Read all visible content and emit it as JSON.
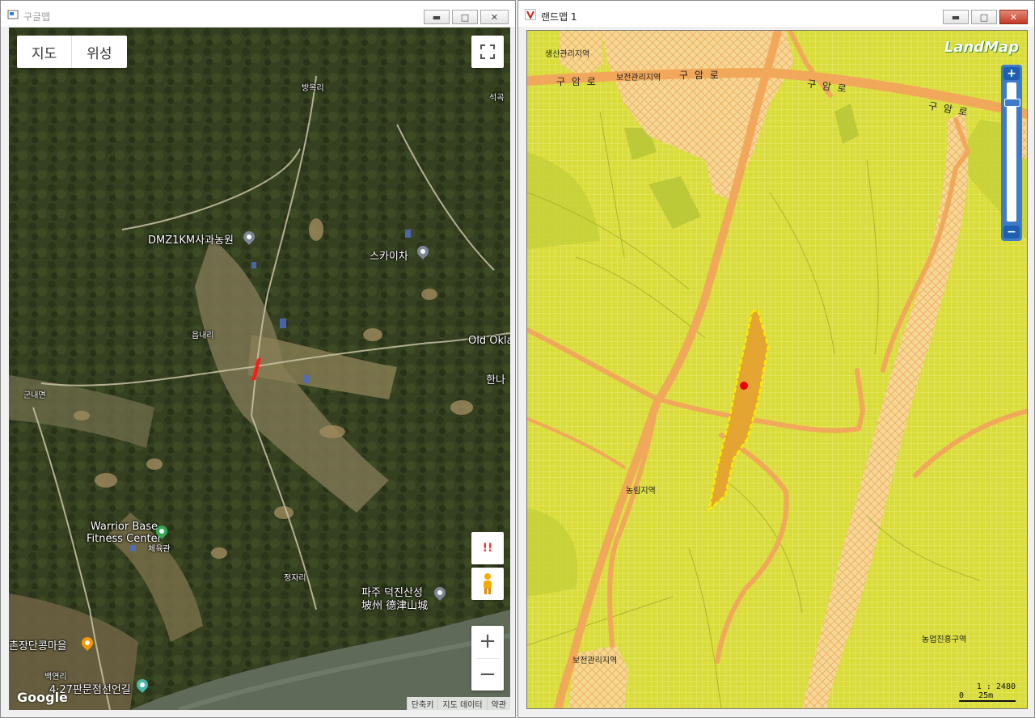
{
  "left_window": {
    "title": "구글맵",
    "map_type": {
      "map": "지도",
      "satellite": "위성"
    },
    "labels": {
      "bangmok": "방목리",
      "seokgok": "석곡",
      "dmz": "DMZ1KM사과농원",
      "skycha": "스카이차",
      "eupnae": "읍내리",
      "oldokla": "Old Okla",
      "hanna": "한나",
      "gunnae": "군내면",
      "warrior": "Warrior Base\nFitness Center",
      "cheyuk": "체육관",
      "jeongja": "정자리",
      "deokjin_ko": "파주 덕진산성",
      "deokjin_cn": "坡州 德津山城",
      "jangdan": "촌장단콩마을",
      "baekyeon": "백연리",
      "panmun": "4·27판문점선언길"
    },
    "google_logo": "Google",
    "attribution": [
      "단축키",
      "지도 데이터",
      "약관"
    ],
    "alert_icon_text": "!!",
    "zoom_in": "+",
    "zoom_out": "−"
  },
  "right_window": {
    "title": "랜드맵 1",
    "logo": "LandMap",
    "zones": {
      "saengsan": "생산관리지역",
      "bojeon_top": "보전관리지역",
      "nongrim": "농림지역",
      "bojeon_bottom": "보전관리지역",
      "nongup": "농업진흥구역"
    },
    "road_labels": [
      "구 암 로",
      "구 암 로",
      "구 암 로",
      "구 암 로"
    ],
    "scale_ratio": "1 : 2480",
    "scale_bar": "0   25m",
    "zoom_plus": "+",
    "zoom_minus": "−"
  }
}
